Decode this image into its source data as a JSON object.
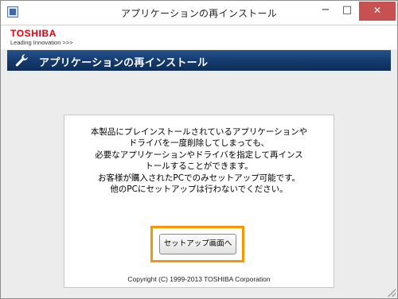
{
  "window": {
    "title": "アプリケーションの再インストール",
    "minimize_label": "−",
    "maximize_label": "□",
    "close_label": "✕"
  },
  "brand": {
    "logo": "TOSHIBA",
    "tagline": "Leading Innovation >>>",
    "logo_color": "#e60012"
  },
  "banner": {
    "icon": "wrench-icon",
    "title": "アプリケーションの再インストール",
    "color": "#143a6d"
  },
  "panel": {
    "message_lines": [
      "本製品にプレインストールされているアプリケーションや",
      "ドライバを一度削除してしまっても、",
      "必要なアプリケーションやドライバを指定して再インス",
      "トールすることができます。",
      "お客様が購入されたPCでのみセットアップ可能です。",
      "他のPCにセットアップは行わないでください。"
    ],
    "setup_button_label": "セットアップ画面へ",
    "highlight_color": "#f39800",
    "copyright": "Copyright (C) 1999-2013 TOSHIBA Corporation"
  }
}
